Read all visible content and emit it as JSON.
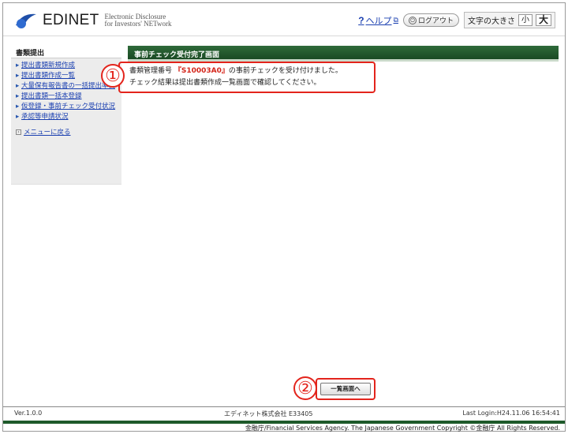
{
  "header": {
    "brand": "EDINET",
    "brand_sub_1": "Electronic Disclosure",
    "brand_sub_2": "for Investors' NETwork",
    "help_label": "ヘルプ",
    "logout_label": "ログアウト",
    "font_size_label": "文字の大きさ",
    "font_small": "小",
    "font_large": "大"
  },
  "sidebar": {
    "title": "書類提出",
    "items": [
      "提出書類新規作成",
      "提出書類作成一覧",
      "大量保有報告書の一括提出準備",
      "提出書類一括本登録",
      "仮登録・事前チェック受付状況",
      "承認等申請状況"
    ],
    "back_label": "メニューに戻る"
  },
  "main": {
    "title": "事前チェック受付完了画面",
    "msg_prefix": "書類管理番号",
    "doc_number": "『S10003A0』",
    "msg_suffix": "の事前チェックを受け付けました。",
    "msg_line2": "チェック結果は提出書類作成一覧画面で確認してください。",
    "list_button": "一覧画面へ"
  },
  "callouts": {
    "one": "①",
    "two": "②"
  },
  "footer": {
    "version": "Ver.1.0.0",
    "org": "エディネット株式会社 E33405",
    "last_login": "Last Login:H24.11.06 16:54:41",
    "copyright": "金融庁/Financial Services Agency. The Japanese Government Copyright ©金融庁 All Rights Reserved."
  },
  "colors": {
    "title_bar": "#1a4a23",
    "callout": "#e3241c",
    "link": "#1a3fb0"
  }
}
